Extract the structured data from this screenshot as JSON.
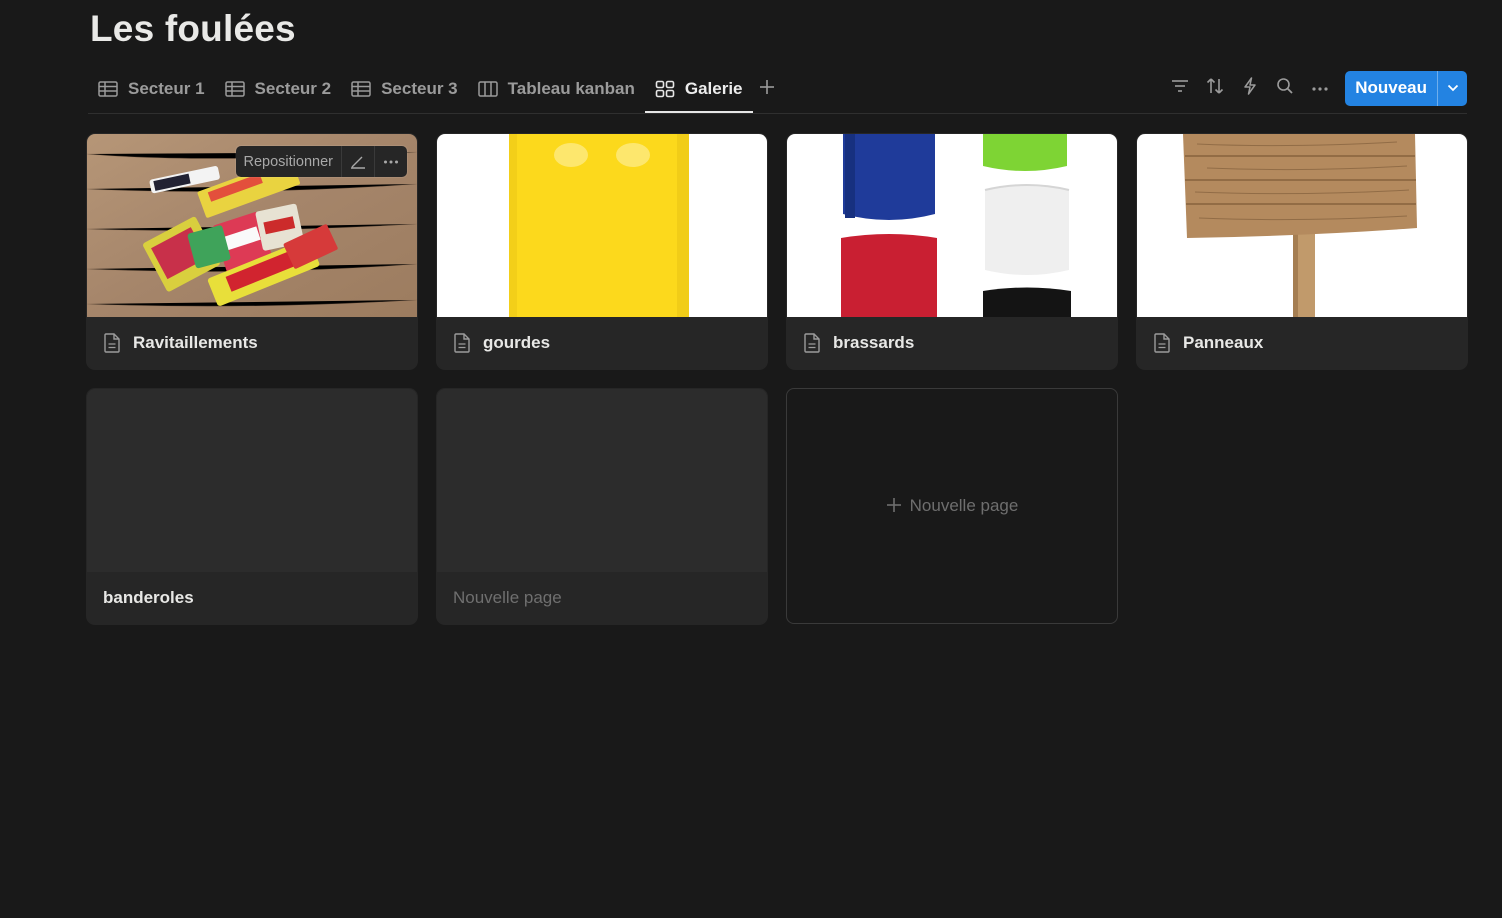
{
  "page": {
    "title": "Les foulées"
  },
  "tabs": [
    {
      "label": "Secteur 1",
      "icon": "table-icon"
    },
    {
      "label": "Secteur 2",
      "icon": "table-icon"
    },
    {
      "label": "Secteur 3",
      "icon": "table-icon"
    },
    {
      "label": "Tableau kanban",
      "icon": "board-icon"
    },
    {
      "label": "Galerie",
      "icon": "gallery-icon",
      "active": true
    }
  ],
  "toolbar": {
    "icons": [
      "filter-icon",
      "sort-icon",
      "automation-icon",
      "search-icon",
      "more-icon"
    ],
    "new_label": "Nouveau",
    "accent": "#2383e2"
  },
  "cards": [
    {
      "title": "Ravitaillements",
      "cover": "energy-gels-photo",
      "menu": {
        "reposition_label": "Repositionner"
      }
    },
    {
      "title": "gourdes",
      "cover": "yellow-bottle-photo"
    },
    {
      "title": "brassards",
      "cover": "armbands-photo"
    },
    {
      "title": "Panneaux",
      "cover": "wooden-sign-photo"
    },
    {
      "title": "banderoles"
    },
    {
      "title": "Nouvelle page"
    }
  ],
  "new_page": {
    "label": "Nouvelle page"
  }
}
